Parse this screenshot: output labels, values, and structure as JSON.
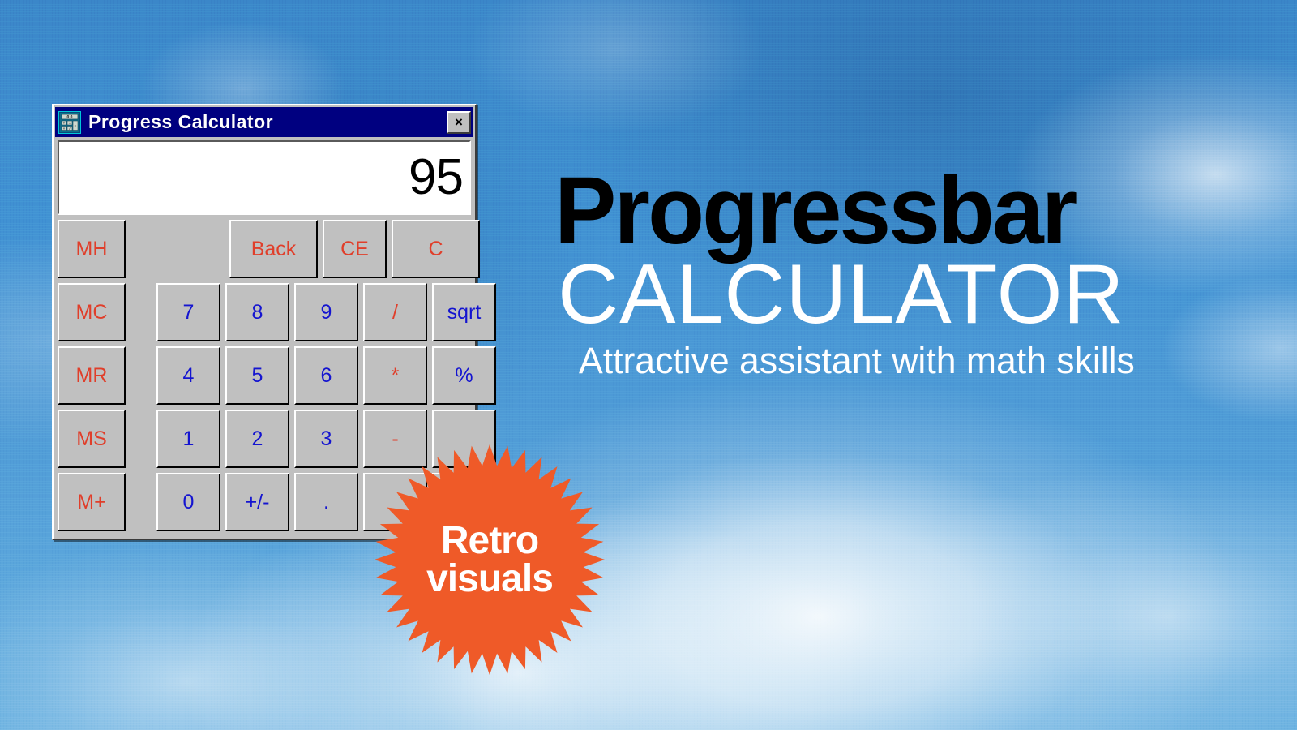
{
  "background": {
    "description": "blue sky with white clouds",
    "sky_color": "#4192d3",
    "cloud_color": "#ffffff"
  },
  "window": {
    "title": "Progress Calculator",
    "icon": "calculator-icon",
    "icon_display": "0.0",
    "icon_keys": [
      "+",
      "-",
      "=",
      "x",
      "/"
    ],
    "titlebar_color": "#000080",
    "close_label": "×",
    "display_value": "95",
    "face_color": "#c0c0c0",
    "memory_color": "#e03e2a",
    "digit_color": "#1414d0"
  },
  "keypad": {
    "rows": [
      {
        "memory": "MH",
        "keys": [
          {
            "label": "Back",
            "style": "red",
            "size": "wide"
          },
          {
            "label": "CE",
            "style": "red",
            "size": "key"
          },
          {
            "label": "C",
            "style": "red",
            "size": "wide"
          }
        ],
        "leading_spacer": true
      },
      {
        "memory": "MC",
        "keys": [
          {
            "label": "7",
            "style": "blue",
            "size": "key"
          },
          {
            "label": "8",
            "style": "blue",
            "size": "key"
          },
          {
            "label": "9",
            "style": "blue",
            "size": "key"
          },
          {
            "label": "/",
            "style": "red",
            "size": "key"
          },
          {
            "label": "sqrt",
            "style": "blue",
            "size": "key"
          }
        ],
        "leading_spacer": false
      },
      {
        "memory": "MR",
        "keys": [
          {
            "label": "4",
            "style": "blue",
            "size": "key"
          },
          {
            "label": "5",
            "style": "blue",
            "size": "key"
          },
          {
            "label": "6",
            "style": "blue",
            "size": "key"
          },
          {
            "label": "*",
            "style": "red",
            "size": "key"
          },
          {
            "label": "%",
            "style": "blue",
            "size": "key"
          }
        ],
        "leading_spacer": false
      },
      {
        "memory": "MS",
        "keys": [
          {
            "label": "1",
            "style": "blue",
            "size": "key"
          },
          {
            "label": "2",
            "style": "blue",
            "size": "key"
          },
          {
            "label": "3",
            "style": "blue",
            "size": "key"
          },
          {
            "label": "-",
            "style": "red",
            "size": "key"
          },
          {
            "label": "",
            "style": "blue",
            "size": "key"
          }
        ],
        "leading_spacer": false
      },
      {
        "memory": "M+",
        "keys": [
          {
            "label": "0",
            "style": "blue",
            "size": "key"
          },
          {
            "label": "+/-",
            "style": "blue",
            "size": "key"
          },
          {
            "label": ".",
            "style": "blue",
            "size": "key"
          },
          {
            "label": "",
            "style": "red",
            "size": "key"
          },
          {
            "label": "",
            "style": "red",
            "size": "key"
          }
        ],
        "leading_spacer": false
      }
    ]
  },
  "headline": {
    "line1": "Progressbar",
    "line2": "CALCULATOR",
    "tagline": "Attractive assistant with math skills",
    "line1_color": "#000000",
    "line2_color": "#ffffff"
  },
  "badge": {
    "line1": "Retro",
    "line2": "visuals",
    "color": "#ef5a28",
    "text_color": "#ffffff",
    "points": 40
  }
}
